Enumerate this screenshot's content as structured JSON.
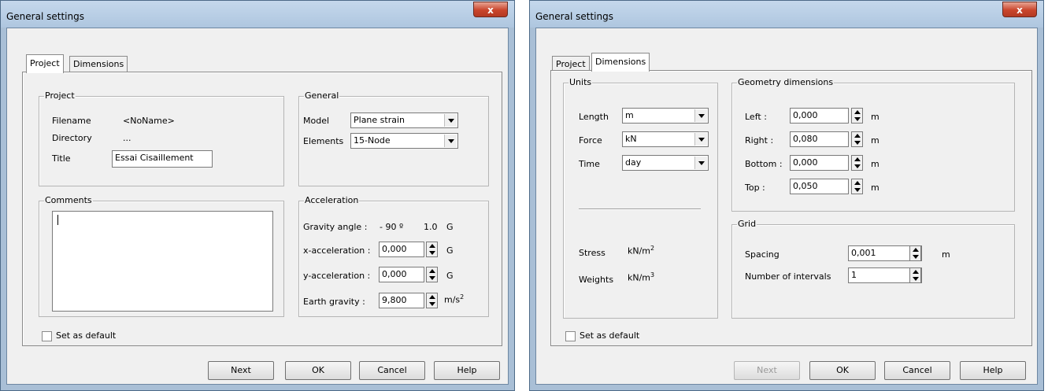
{
  "left": {
    "title": "General settings",
    "close_label": "x",
    "tabs": [
      "Project",
      "Dimensions"
    ],
    "project_group": {
      "legend": "Project",
      "filename_label": "Filename",
      "filename_value": "<NoName>",
      "directory_label": "Directory",
      "directory_value": "...",
      "title_label": "Title",
      "title_value": "Essai Cisaillement"
    },
    "general_group": {
      "legend": "General",
      "model_label": "Model",
      "model_value": "Plane strain",
      "elements_label": "Elements",
      "elements_value": "15-Node"
    },
    "comments_group": {
      "legend": "Comments",
      "value": ""
    },
    "acceleration_group": {
      "legend": "Acceleration",
      "gravity_angle_label": "Gravity angle :",
      "gravity_angle_value": "- 90 º",
      "gravity_g_value": "1.0",
      "gravity_g_unit": "G",
      "x_label": "x-acceleration :",
      "x_value": "0,000",
      "x_unit": "G",
      "y_label": "y-acceleration :",
      "y_value": "0,000",
      "y_unit": "G",
      "earth_label": "Earth gravity :",
      "earth_value": "9,800",
      "earth_unit": "m/s",
      "earth_unit_sup": "2"
    },
    "set_default": "Set as default",
    "buttons": {
      "next": "Next",
      "ok": "OK",
      "cancel": "Cancel",
      "help": "Help"
    }
  },
  "right": {
    "title": "General settings",
    "close_label": "x",
    "tabs": [
      "Project",
      "Dimensions"
    ],
    "units_group": {
      "legend": "Units",
      "length_label": "Length",
      "length_value": "m",
      "force_label": "Force",
      "force_value": "kN",
      "time_label": "Time",
      "time_value": "day",
      "stress_label": "Stress",
      "stress_unit": "kN/m",
      "stress_sup": "2",
      "weights_label": "Weights",
      "weights_unit": "kN/m",
      "weights_sup": "3"
    },
    "geometry_group": {
      "legend": "Geometry dimensions",
      "left_label": "Left :",
      "left_value": "0,000",
      "left_unit": "m",
      "right_label": "Right :",
      "right_value": "0,080",
      "right_unit": "m",
      "bottom_label": "Bottom :",
      "bottom_value": "0,000",
      "bottom_unit": "m",
      "top_label": "Top :",
      "top_value": "0,050",
      "top_unit": "m"
    },
    "grid_group": {
      "legend": "Grid",
      "spacing_label": "Spacing",
      "spacing_value": "0,001",
      "spacing_unit": "m",
      "intervals_label": "Number of intervals",
      "intervals_value": "1"
    },
    "set_default": "Set as default",
    "buttons": {
      "next": "Next",
      "ok": "OK",
      "cancel": "Cancel",
      "help": "Help"
    }
  },
  "colors": {
    "title_bar": "#aec6df",
    "close_button": "#c9452c",
    "dialog_bg": "#f0f0f0"
  }
}
